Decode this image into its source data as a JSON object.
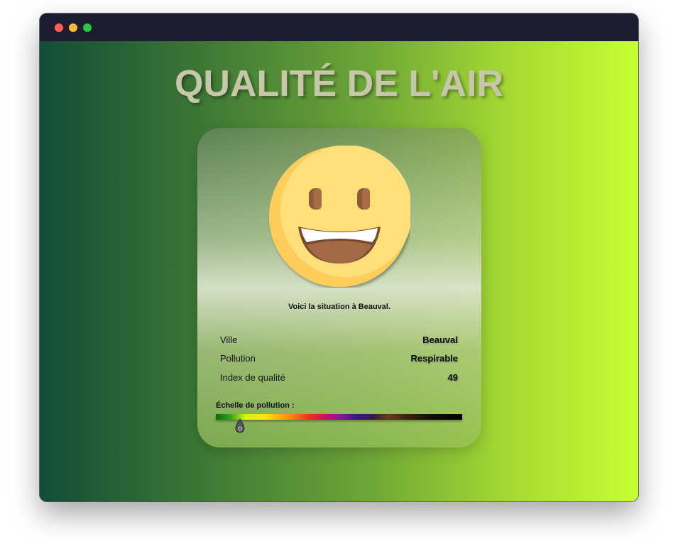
{
  "window": {
    "controls": [
      "close",
      "minimize",
      "maximize"
    ]
  },
  "page": {
    "title": "QUALITÉ DE L'AIR"
  },
  "card": {
    "emoji": "grinning-face-icon",
    "situation_text": "Voici la situation à Beauval.",
    "rows": [
      {
        "label": "Ville",
        "value": "Beauval"
      },
      {
        "label": "Pollution",
        "value": "Respirable"
      },
      {
        "label": "Index de qualité",
        "value": "49"
      }
    ],
    "scale": {
      "label": "Échelle de pollution :",
      "marker_icon": "location-pin-icon"
    }
  },
  "colors": {
    "title": "#c5c7a8",
    "gradient_start": "#124c37",
    "gradient_end": "#c6ff33",
    "titlebar": "#1d1d30"
  }
}
